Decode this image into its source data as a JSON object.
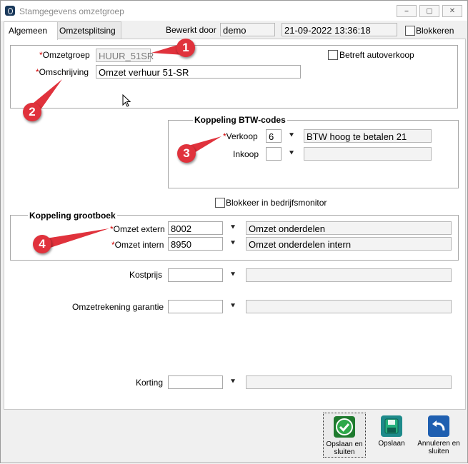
{
  "window": {
    "title": "Stamgegevens omzetgroep",
    "controls": {
      "minimize": "⎯",
      "maximize": "▢",
      "close": "✕"
    }
  },
  "tabs": [
    {
      "label": "Algemeen",
      "active": true
    },
    {
      "label": "Omzetsplitsing",
      "active": false
    }
  ],
  "header": {
    "bewerkt_door_label": "Bewerkt door",
    "bewerkt_door_value": "demo",
    "timestamp": "21-09-2022 13:36:18",
    "blokkeren_label": "Blokkeren"
  },
  "general": {
    "omzetgroep_label": "Omzetgroep",
    "omzetgroep_value": "HUUR_51SR",
    "omschrijving_label": "Omschrijving",
    "omschrijving_value": "Omzet verhuur 51-SR",
    "betreft_autoverkoop_label": "Betreft autoverkoop",
    "required_marker": "*"
  },
  "btw": {
    "title": "Koppeling BTW-codes",
    "verkoop_label": "Verkoop",
    "verkoop_code": "6",
    "verkoop_desc": "BTW hoog te betalen 21",
    "inkoop_label": "Inkoop",
    "inkoop_code": "",
    "inkoop_desc": ""
  },
  "blokkeer_monitor_label": "Blokkeer in bedrijfsmonitor",
  "grootboek": {
    "title": "Koppeling grootboek",
    "extern_label": "Omzet extern",
    "extern_code": "8002",
    "extern_desc": "Omzet onderdelen",
    "intern_label": "Omzet intern",
    "intern_code": "8950",
    "intern_desc": "Omzet onderdelen intern"
  },
  "other": {
    "kostprijs_label": "Kostprijs",
    "garantie_label": "Omzetrekening garantie",
    "korting_label": "Korting"
  },
  "buttons": {
    "save_close": "Opslaan en sluiten",
    "save": "Opslaan",
    "cancel_close": "Annuleren en sluiten"
  },
  "callouts": [
    "1",
    "2",
    "3",
    "4"
  ],
  "icons": {
    "dropdown": "⯆",
    "save_close": "check-icon",
    "save": "floppy-icon",
    "cancel": "undo-icon"
  },
  "colors": {
    "callout": "#e0323c",
    "required": "#d00000",
    "save_close_icon": "#1e7a2e",
    "save_icon": "#1e8a8a",
    "cancel_icon": "#1f5fb0"
  }
}
